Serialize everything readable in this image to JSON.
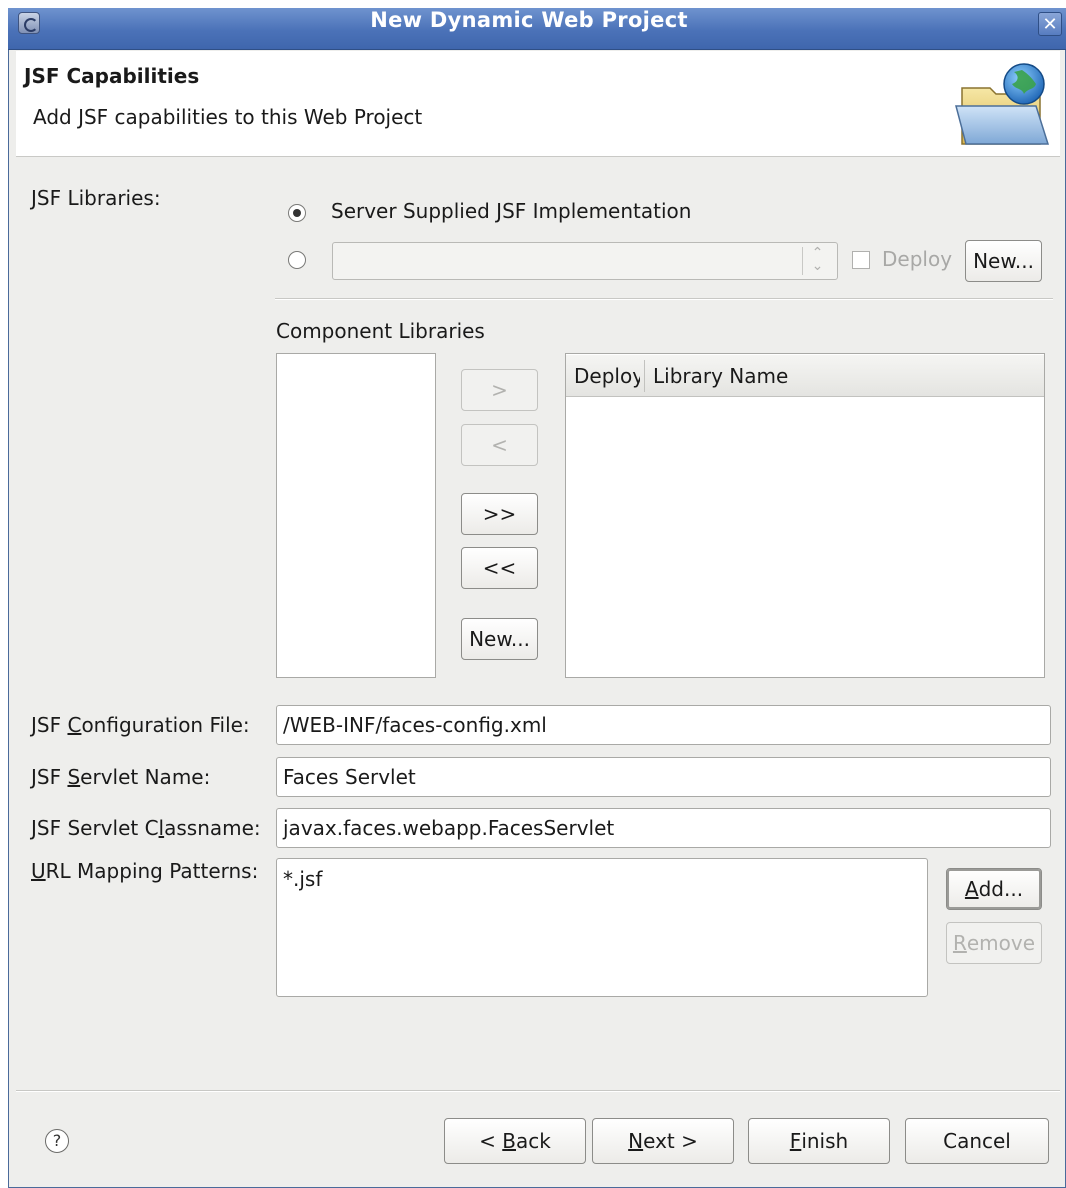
{
  "window": {
    "title": "New Dynamic Web Project",
    "close_glyph": "✕"
  },
  "banner": {
    "title": "JSF Capabilities",
    "description": "Add JSF capabilities to this Web Project",
    "icon": "folder-globe-icon"
  },
  "jsf_libraries": {
    "label": "JSF Libraries:",
    "option_server": "Server Supplied JSF Implementation",
    "selected": "server",
    "library_combo_value": "",
    "deploy_label": "Deploy",
    "deploy_checked": false,
    "new_button": "New..."
  },
  "component_libraries": {
    "label": "Component Libraries",
    "available_items": [],
    "buttons": {
      "add": ">",
      "remove": "<",
      "add_all": ">>",
      "remove_all": "<<",
      "new": "New..."
    },
    "table_columns": [
      "Deploy",
      "Library Name"
    ],
    "table_rows": []
  },
  "config": {
    "config_file_label_pre": "JSF ",
    "config_file_label_u": "C",
    "config_file_label_post": "onfiguration File:",
    "config_file_value": "/WEB-INF/faces-config.xml",
    "servlet_name_label_pre": "JSF ",
    "servlet_name_label_u": "S",
    "servlet_name_label_post": "ervlet Name:",
    "servlet_name_value": "Faces Servlet",
    "servlet_class_label_pre": "JSF Servlet C",
    "servlet_class_label_u": "l",
    "servlet_class_label_post": "assname:",
    "servlet_class_value": "javax.faces.webapp.FacesServlet",
    "url_label_u": "U",
    "url_label_post": "RL Mapping Patterns:",
    "url_patterns": [
      "*.jsf"
    ],
    "add_u": "A",
    "add_post": "dd...",
    "remove_u": "R",
    "remove_post": "emove"
  },
  "footer": {
    "help_glyph": "?",
    "back_pre": "< ",
    "back_u": "B",
    "back_post": "ack",
    "next_u": "N",
    "next_post": "ext >",
    "finish_u": "F",
    "finish_post": "inish",
    "cancel": "Cancel"
  }
}
